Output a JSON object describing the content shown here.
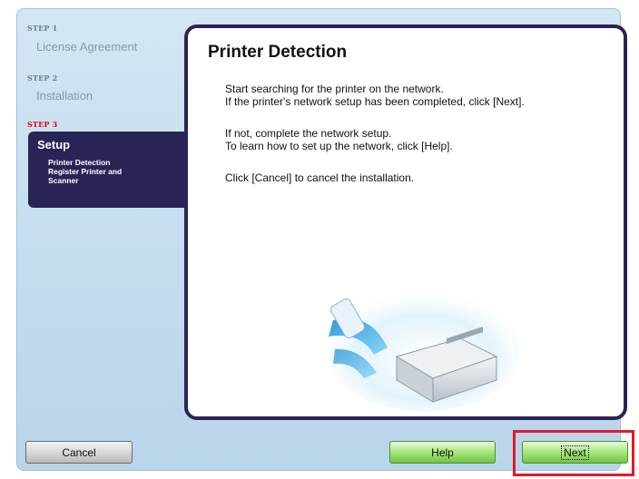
{
  "sidebar": {
    "steps": [
      {
        "tag": "STEP 1",
        "name": "License Agreement"
      },
      {
        "tag": "STEP 2",
        "name": "Installation"
      },
      {
        "tag": "STEP 3",
        "name": "Setup"
      }
    ],
    "substeps": [
      "Printer Detection",
      "Register Printer and",
      "Scanner"
    ]
  },
  "main": {
    "title": "Printer Detection",
    "paragraphs": [
      "Start searching for the printer on the network.",
      "If the printer's network setup has been completed, click [Next].",
      "If not, complete the network setup.",
      "To learn how to set up the network, click [Help].",
      "Click [Cancel] to cancel the installation."
    ]
  },
  "buttons": {
    "cancel": "Cancel",
    "help": "Help",
    "next": "Next"
  },
  "colors": {
    "accent": "#2a2456",
    "active_step": "#e0001b",
    "highlight": "#e01a2a",
    "green_button": "#a6e67c"
  }
}
